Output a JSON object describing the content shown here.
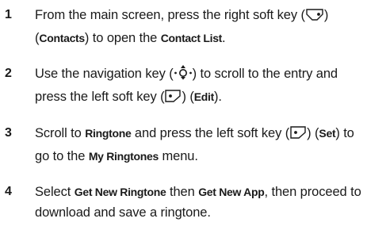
{
  "steps": [
    {
      "number": "1",
      "parts": [
        {
          "t": "text",
          "v": "From the main screen, press the right soft key ("
        },
        {
          "t": "icon",
          "v": "right-soft-key-icon"
        },
        {
          "t": "text",
          "v": ") ("
        },
        {
          "t": "key",
          "v": "Contacts"
        },
        {
          "t": "text",
          "v": ") to open the "
        },
        {
          "t": "key",
          "v": "Contact List"
        },
        {
          "t": "text",
          "v": "."
        }
      ]
    },
    {
      "number": "2",
      "parts": [
        {
          "t": "text",
          "v": "Use the navigation key ("
        },
        {
          "t": "icon",
          "v": "navigation-key-icon"
        },
        {
          "t": "text",
          "v": ") to scroll to the entry and press the left soft key ("
        },
        {
          "t": "icon",
          "v": "left-soft-key-icon"
        },
        {
          "t": "text",
          "v": ") ("
        },
        {
          "t": "key",
          "v": "Edit"
        },
        {
          "t": "text",
          "v": ")."
        }
      ]
    },
    {
      "number": "3",
      "parts": [
        {
          "t": "text",
          "v": "Scroll to "
        },
        {
          "t": "key",
          "v": "Ringtone"
        },
        {
          "t": "text",
          "v": " and press the left soft key ("
        },
        {
          "t": "icon",
          "v": "left-soft-key-icon"
        },
        {
          "t": "text",
          "v": ") ("
        },
        {
          "t": "key",
          "v": "Set"
        },
        {
          "t": "text",
          "v": ") to go to the "
        },
        {
          "t": "key",
          "v": "My Ringtones"
        },
        {
          "t": "text",
          "v": " menu."
        }
      ]
    },
    {
      "number": "4",
      "parts": [
        {
          "t": "text",
          "v": "Select "
        },
        {
          "t": "key",
          "v": "Get New Ringtone"
        },
        {
          "t": "text",
          "v": " then "
        },
        {
          "t": "key",
          "v": "Get New App"
        },
        {
          "t": "text",
          "v": ", then proceed to download and save a ringtone."
        }
      ]
    }
  ]
}
